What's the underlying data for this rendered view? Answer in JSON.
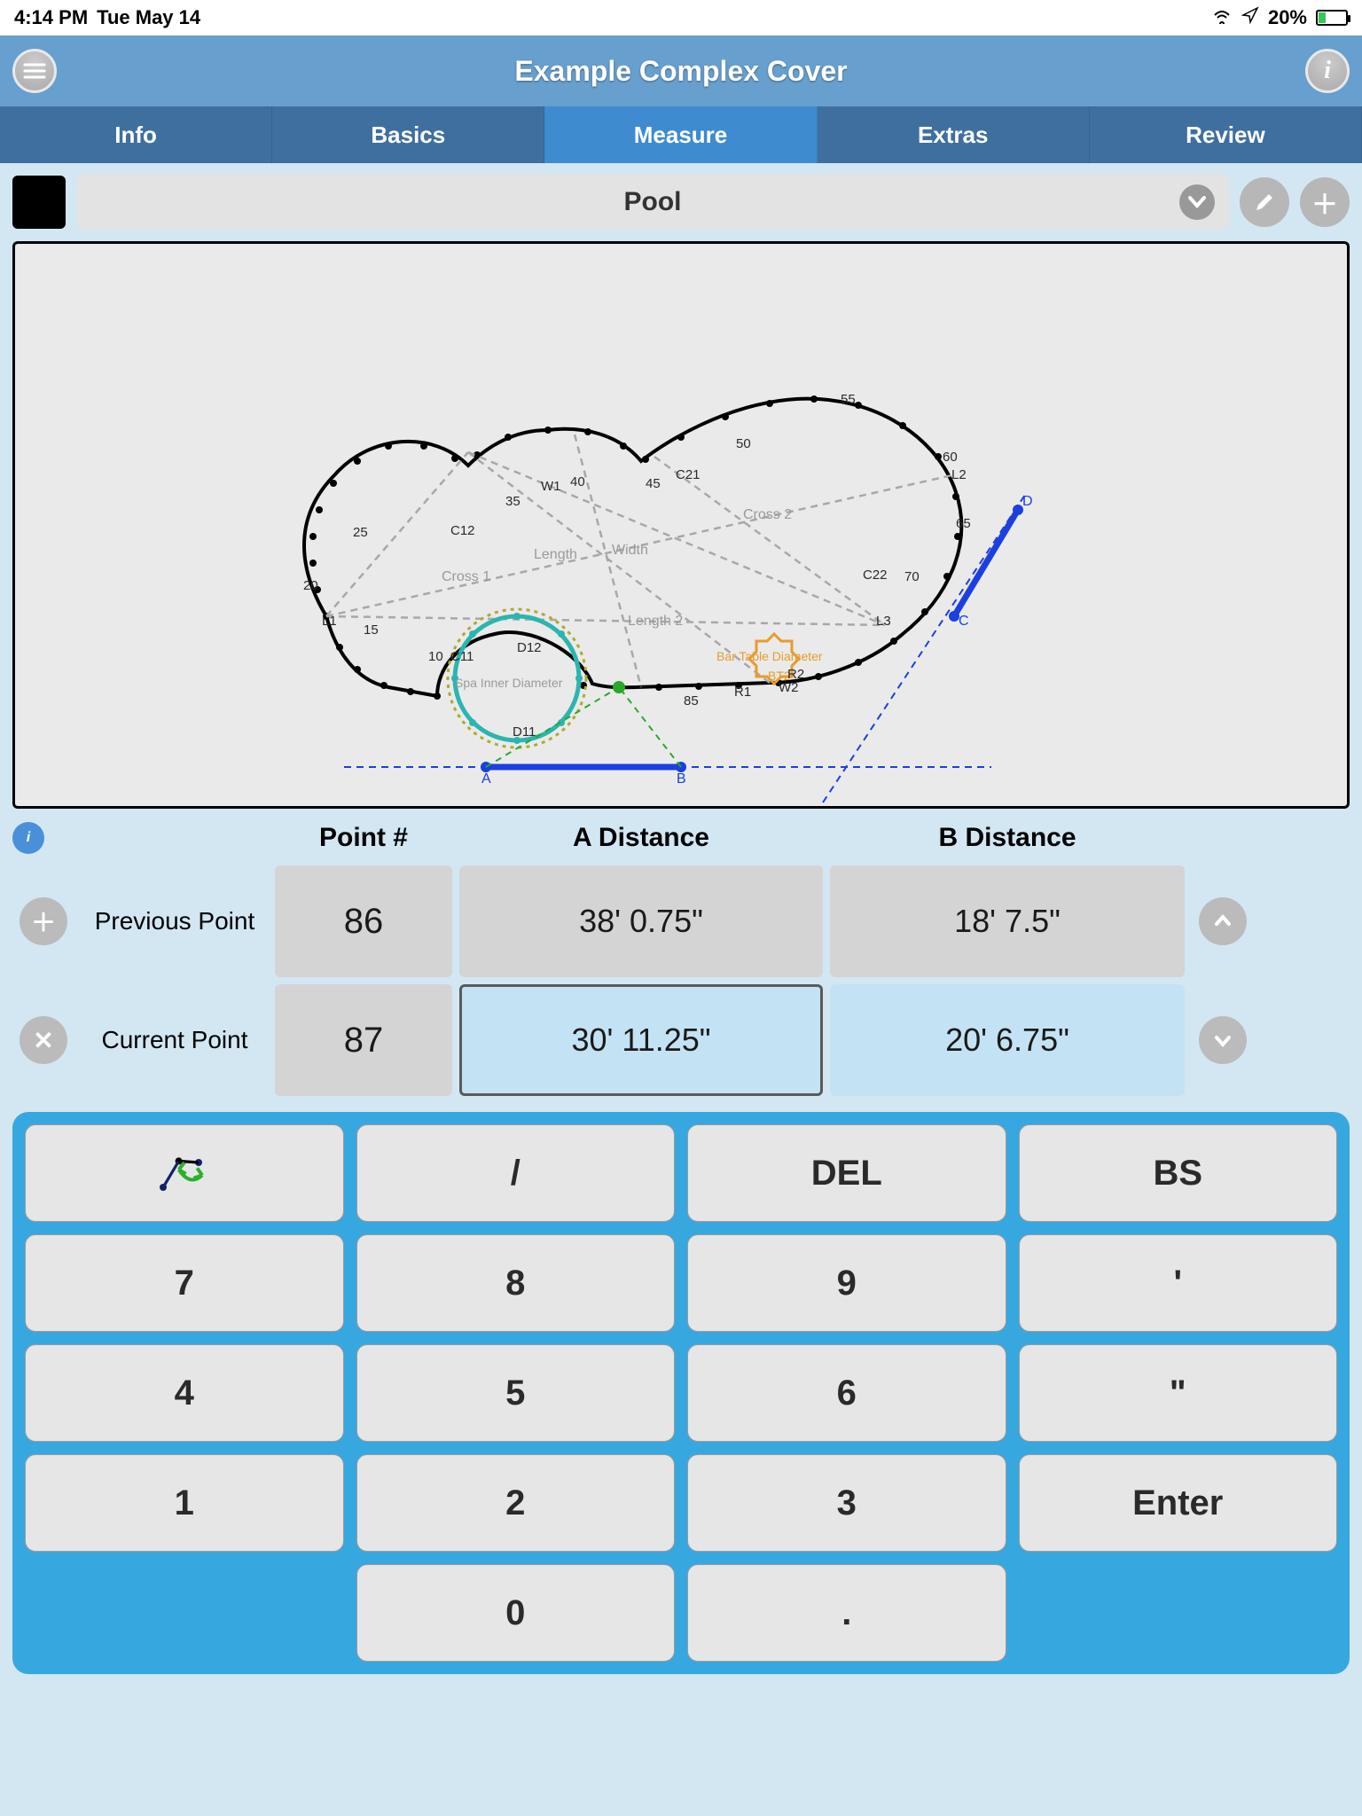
{
  "status": {
    "time": "4:14 PM",
    "date": "Tue May 14",
    "battery_pct": "20%"
  },
  "title": "Example Complex Cover",
  "tabs": [
    "Info",
    "Basics",
    "Measure",
    "Extras",
    "Review"
  ],
  "active_tab_index": 2,
  "object": {
    "name": "Pool"
  },
  "headers": {
    "point": "Point #",
    "a": "A Distance",
    "b": "B Distance"
  },
  "rows": {
    "prev": {
      "label": "Previous Point",
      "pt": "86",
      "a": "38' 0.75\"",
      "b": "18' 7.5\""
    },
    "cur": {
      "label": "Current Point",
      "pt": "87",
      "a": "30' 11.25\"",
      "b": "20' 6.75\""
    }
  },
  "keypad": {
    "slash": "/",
    "del": "DEL",
    "bs": "BS",
    "k7": "7",
    "k8": "8",
    "k9": "9",
    "ft": "'",
    "k4": "4",
    "k5": "5",
    "k6": "6",
    "in": "\"",
    "k1": "1",
    "k2": "2",
    "k3": "3",
    "enter": "Enter",
    "k0": "0",
    "dot": "."
  },
  "diagram": {
    "point_labels": [
      "15",
      "20",
      "25",
      "35",
      "40",
      "45",
      "50",
      "55",
      "60",
      "65",
      "70",
      "85",
      "10"
    ],
    "named_points": [
      "L1",
      "L2",
      "L3",
      "W1",
      "W2",
      "C11",
      "C12",
      "C21",
      "C22",
      "R1",
      "R2",
      "A",
      "B",
      "C",
      "D",
      "D11",
      "D12",
      "BT2"
    ],
    "text_labels": [
      "Length",
      "Length 2",
      "Width",
      "Cross 1",
      "Cross 2",
      "Bar Table Diameter",
      "Spa Inner Diameter"
    ]
  }
}
